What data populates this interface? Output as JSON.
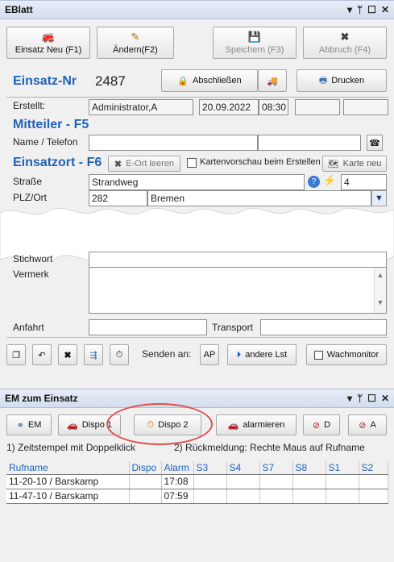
{
  "panel1": {
    "title": "EBlatt",
    "toolbar": [
      {
        "label": "Einsatz Neu (F1)",
        "icon": "new-incident-icon"
      },
      {
        "label": "Ändern(F2)",
        "icon": "edit-icon"
      },
      {
        "label": "Speichern (F3)",
        "icon": "save-icon"
      },
      {
        "label": "Abbruch (F4)",
        "icon": "cancel-icon"
      }
    ],
    "einsatz_nr_label": "Einsatz-Nr",
    "einsatz_nr": "2487",
    "abschliessen_label": "Abschließen",
    "drucken_label": "Drucken",
    "erstellt_label": "Erstellt:",
    "erstellt_user": "Administrator,A",
    "erstellt_date": "20.09.2022",
    "erstellt_time": "08:30",
    "mitteiler_heading": "Mitteiler  -  F5",
    "name_tel_label": "Name / Telefon",
    "einsatzort_heading": "Einsatzort - F6",
    "eort_leeren_label": "E-Ort leeren",
    "kartenvorschau_label": "Kartenvorschau beim Erstellen",
    "karte_neu_label": "Karte neu",
    "strasse_label": "Straße",
    "strasse_value": "Strandweg",
    "hausnr_value": "4",
    "plz_ort_label": "PLZ/Ort",
    "plz_value": "282",
    "ort_value": "Bremen",
    "stichwort_label": "Stichwort",
    "vermerk_label": "Vermerk",
    "anfahrt_label": "Anfahrt",
    "transport_label": "Transport",
    "senden_an_label": "Senden an:",
    "ap_label": "AP",
    "andere_lst_label": "andere Lst",
    "wachmonitor_label": "Wachmonitor"
  },
  "panel2": {
    "title": "EM zum Einsatz",
    "toolbar": [
      {
        "label": "EM",
        "icon": "binoculars-icon"
      },
      {
        "label": "Dispo 1",
        "icon": "car-yellow-icon"
      },
      {
        "label": "Dispo 2",
        "icon": "stopwatch-icon"
      },
      {
        "label": "alarmieren",
        "icon": "car-red-icon"
      },
      {
        "label": "D",
        "icon": "car-crossed-d-icon"
      },
      {
        "label": "A",
        "icon": "car-crossed-a-icon"
      }
    ],
    "hint_1": "1) Zeitstempel mit Doppelklick",
    "hint_2": "2) Rückmeldung:  Rechte Maus auf Rufname",
    "columns": [
      "Rufname",
      "Dispo",
      "Alarm",
      "S3",
      "S4",
      "S7",
      "S8",
      "S1",
      "S2"
    ],
    "rows": [
      {
        "rufname": "11-20-10 / Barskamp",
        "dispo": "",
        "alarm": "17:08"
      },
      {
        "rufname": "11-47-10 / Barskamp",
        "dispo": "",
        "alarm": "07:59"
      }
    ]
  },
  "colors": {
    "accent": "#1f62b8",
    "highlight_ring": "#e05050"
  }
}
